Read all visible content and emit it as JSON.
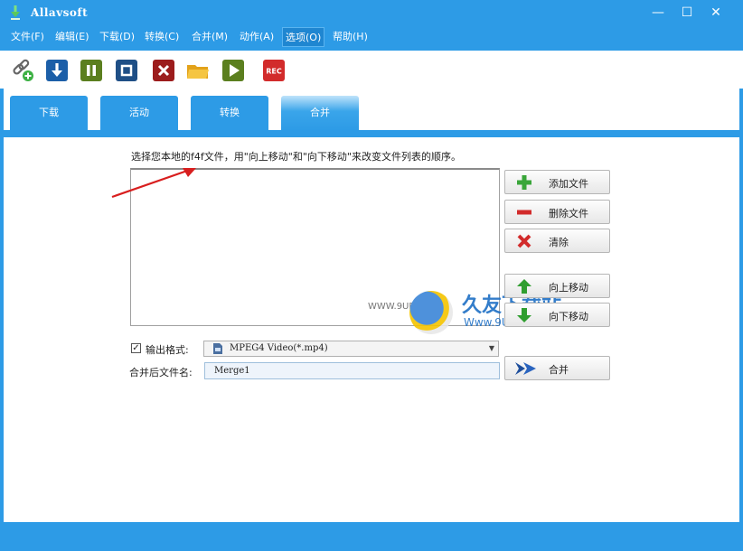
{
  "window": {
    "title": "Allavsoft",
    "minimize": "—",
    "maximize": "☐",
    "close": "✕"
  },
  "menu": [
    "文件(F)",
    "编辑(E)",
    "下载(D)",
    "转换(C)",
    "合并(M)",
    "动作(A)",
    "选项(O)",
    "帮助(H)"
  ],
  "toolbar": {
    "rec_label": "REC"
  },
  "tabs": [
    "下载",
    "活动",
    "转换",
    "合并"
  ],
  "merge": {
    "instruction": "选择您本地的f4f文件，用\"向上移动\"和\"向下移动\"来改变文件列表的顺序。",
    "buttons": {
      "add": "添加文件",
      "delete": "删除文件",
      "clear": "清除",
      "move_up": "向上移动",
      "move_down": "向下移动",
      "merge": "合并"
    },
    "output_format_label": "输出格式:",
    "output_format_value": "MPEG4 Video(*.mp4)",
    "output_checked": true,
    "filename_label": "合并后文件名:",
    "filename_value": "Merge1"
  },
  "watermark": {
    "small": "WWW.9UPK.COM",
    "big": "久友下载站",
    "url": "Www.9UPK.Com"
  },
  "colors": {
    "accent": "#2d9be6"
  }
}
